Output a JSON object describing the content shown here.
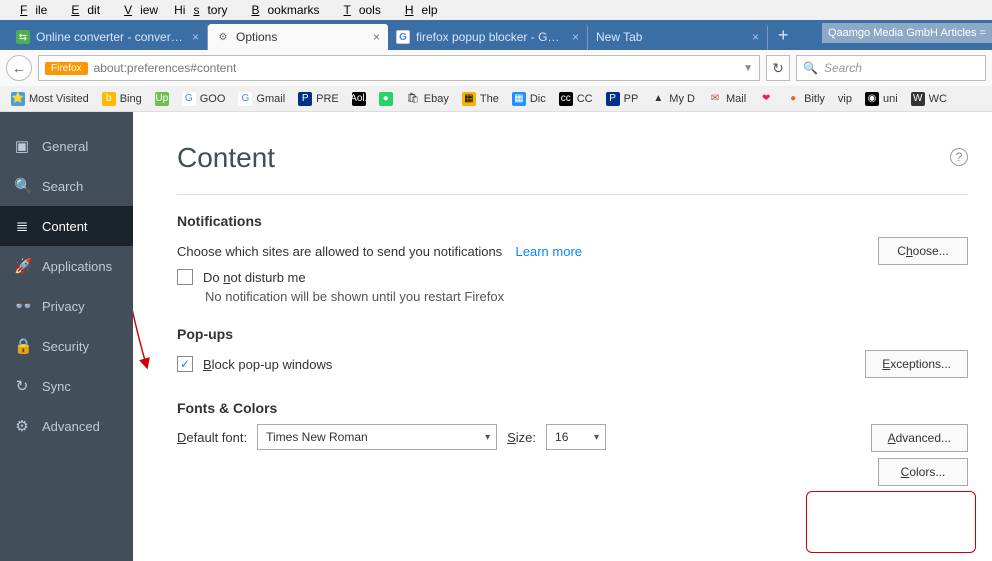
{
  "menu": [
    "File",
    "Edit",
    "View",
    "History",
    "Bookmarks",
    "Tools",
    "Help"
  ],
  "tabs": [
    {
      "label": "Online converter - convert ...",
      "active": false,
      "icon": "green"
    },
    {
      "label": "Options",
      "active": true,
      "icon": "gear"
    },
    {
      "label": "firefox popup blocker - Goo...",
      "active": false,
      "icon": "goog"
    },
    {
      "label": "New Tab",
      "active": false,
      "icon": "none"
    }
  ],
  "overlay_banner": "Qaamgo Media GmbH Articles =",
  "urlbar": {
    "badge": "Firefox",
    "url": "about:preferences#content"
  },
  "search_placeholder": "Search",
  "bookmarks": [
    {
      "label": "Most Visited",
      "ico": "⭐",
      "bg": "#4c9ed9",
      "fg": "#fff"
    },
    {
      "label": "Bing",
      "ico": "b",
      "bg": "#ffb900",
      "fg": "#fff"
    },
    {
      "label": "",
      "ico": "Up",
      "bg": "#6fbf4d",
      "fg": "#fff"
    },
    {
      "label": "GOO",
      "ico": "G",
      "bg": "#fff",
      "fg": "#4285f4"
    },
    {
      "label": "Gmail",
      "ico": "G",
      "bg": "#fff",
      "fg": "#4285f4"
    },
    {
      "label": "PRE",
      "ico": "P",
      "bg": "#003087",
      "fg": "#fff"
    },
    {
      "label": "",
      "ico": "Aol.",
      "bg": "#000",
      "fg": "#fff"
    },
    {
      "label": "",
      "ico": "●",
      "bg": "#25d366",
      "fg": "#fff"
    },
    {
      "label": "Ebay",
      "ico": "🛍",
      "bg": "",
      "fg": ""
    },
    {
      "label": "The",
      "ico": "▦",
      "bg": "#f7b500",
      "fg": "#000"
    },
    {
      "label": "Dic",
      "ico": "▦",
      "bg": "#1e90ff",
      "fg": "#fff"
    },
    {
      "label": "CC",
      "ico": "cc",
      "bg": "#000",
      "fg": "#fff"
    },
    {
      "label": "PP",
      "ico": "P",
      "bg": "#003087",
      "fg": "#fff"
    },
    {
      "label": "My D",
      "ico": "▲",
      "bg": "",
      "fg": ""
    },
    {
      "label": "Mail",
      "ico": "✉",
      "bg": "",
      "fg": "#b94a48"
    },
    {
      "label": "",
      "ico": "❤",
      "bg": "",
      "fg": "#e91e63"
    },
    {
      "label": "Bitly",
      "ico": "●",
      "bg": "",
      "fg": "#ee6123"
    },
    {
      "label": "vip",
      "ico": "",
      "bg": "",
      "fg": ""
    },
    {
      "label": "uni",
      "ico": "◉",
      "bg": "#000",
      "fg": "#fff"
    },
    {
      "label": "WC",
      "ico": "W",
      "bg": "#333",
      "fg": "#fff"
    }
  ],
  "sidebar": [
    {
      "label": "General",
      "icon": "▣"
    },
    {
      "label": "Search",
      "icon": "🔍"
    },
    {
      "label": "Content",
      "icon": "≣",
      "active": true
    },
    {
      "label": "Applications",
      "icon": "🚀"
    },
    {
      "label": "Privacy",
      "icon": "👓"
    },
    {
      "label": "Security",
      "icon": "🔒"
    },
    {
      "label": "Sync",
      "icon": "↻"
    },
    {
      "label": "Advanced",
      "icon": "⚙"
    }
  ],
  "page": {
    "title": "Content",
    "notifications": {
      "heading": "Notifications",
      "desc": "Choose which sites are allowed to send you notifications",
      "learn": "Learn more",
      "btn": "Choose...",
      "dnd": "Do not disturb me",
      "dnd_sub": "No notification will be shown until you restart Firefox"
    },
    "popups": {
      "heading": "Pop-ups",
      "block": "Block pop-up windows",
      "btn": "Exceptions..."
    },
    "fonts": {
      "heading": "Fonts & Colors",
      "default_label": "Default font:",
      "font_value": "Times New Roman",
      "size_label": "Size:",
      "size_value": "16",
      "adv_btn": "Advanced...",
      "colors_btn": "Colors..."
    }
  }
}
